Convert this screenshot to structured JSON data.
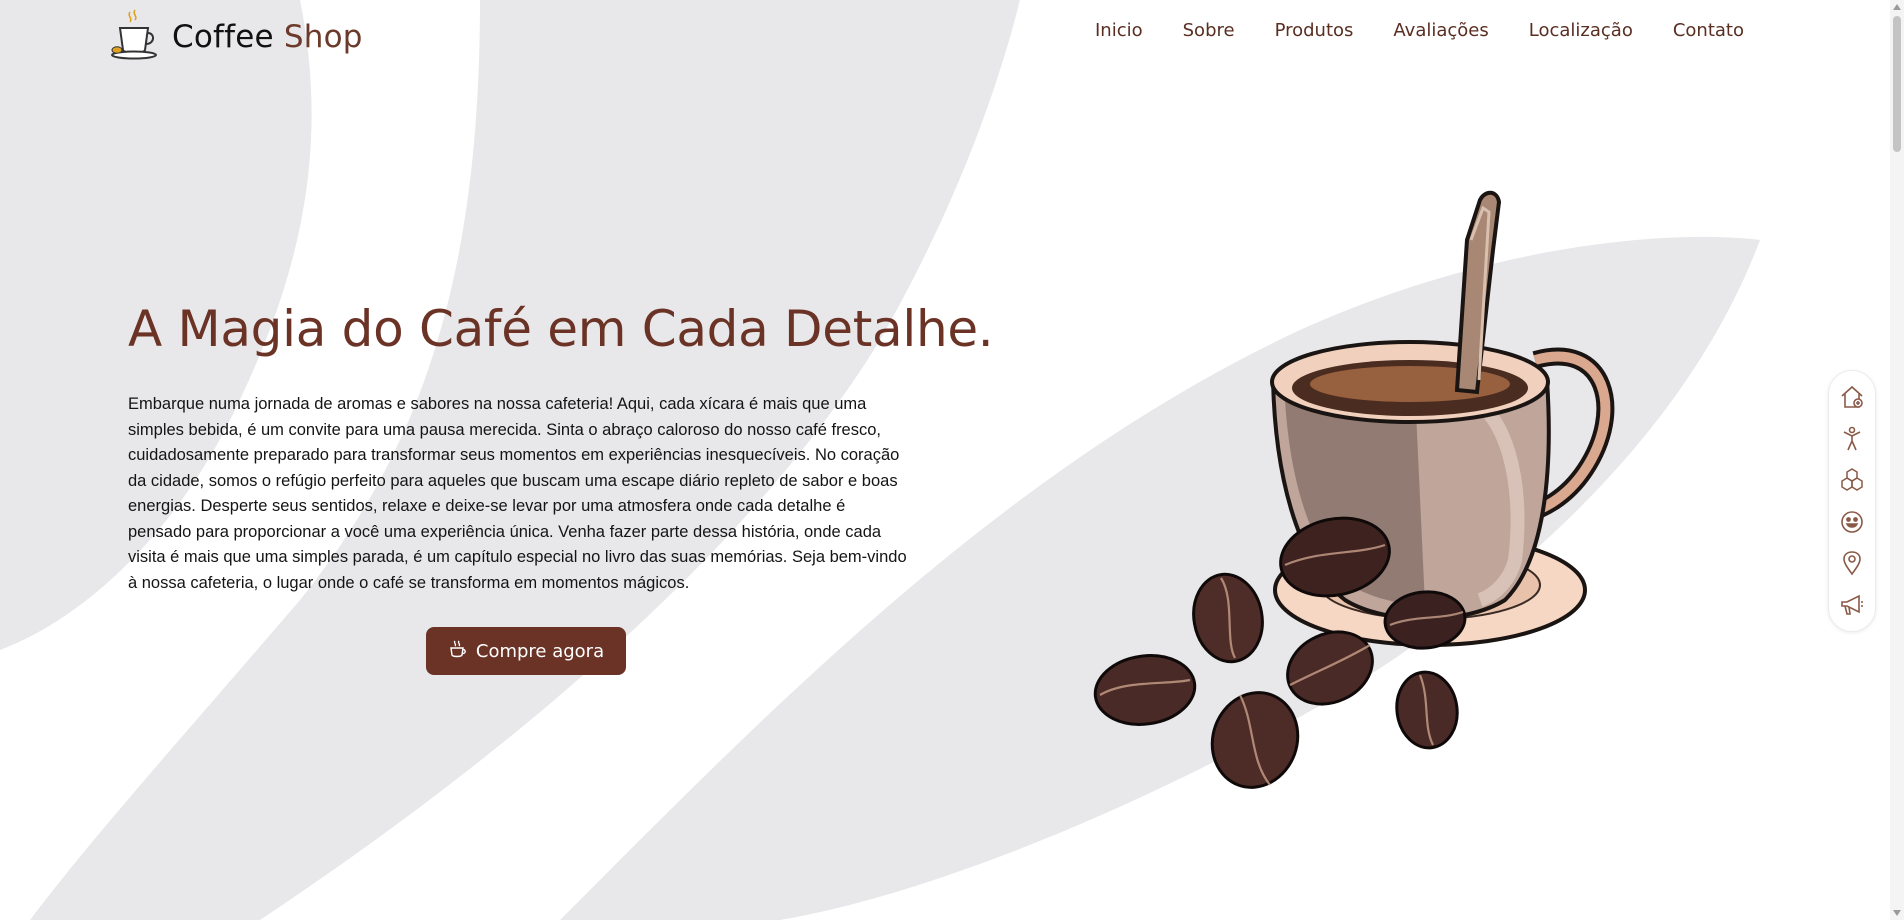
{
  "brand": {
    "name_part1": "Coffee",
    "name_part2": "Shop",
    "logo_icon": "coffee-cup-logo-icon"
  },
  "nav": {
    "items": [
      {
        "label": "Inicio"
      },
      {
        "label": "Sobre"
      },
      {
        "label": "Produtos"
      },
      {
        "label": "Avaliações"
      },
      {
        "label": "Localização"
      },
      {
        "label": "Contato"
      }
    ]
  },
  "hero": {
    "title": "A Magia do Café em Cada Detalhe.",
    "text": "Embarque numa jornada de aromas e sabores na nossa cafeteria! Aqui, cada xícara é mais que uma simples bebida, é um convite para uma pausa merecida. Sinta o abraço caloroso do nosso café fresco, cuidadosamente preparado para transformar seus momentos em experiências inesquecíveis. No coração da cidade, somos o refúgio perfeito para aqueles que buscam uma escape diário repleto de sabor e boas energias. Desperte seus sentidos, relaxe e deixe-se levar por uma atmosfera onde cada detalhe é pensado para proporcionar a você uma experiência única. Venha fazer parte dessa história, onde cada visita é mais que uma simples parada, é um capítulo especial no livro das suas memórias. Seja bem-vindo à nossa cafeteria, o lugar onde o café se transforma em momentos mágicos.",
    "cta_label": "Compre agora",
    "cta_icon": "hot-coffee-icon",
    "image": "coffee-cup-with-beans-illustration"
  },
  "side_dock": {
    "icons": [
      "home-icon",
      "person-icon",
      "boxes-icon",
      "smiley-icon",
      "location-pin-icon",
      "megaphone-icon"
    ]
  },
  "colors": {
    "brand_brown": "#6b3326",
    "nav_text": "#5a2e22",
    "background_shape": "#e8e8ea",
    "icon_brown": "#8a5a48"
  }
}
